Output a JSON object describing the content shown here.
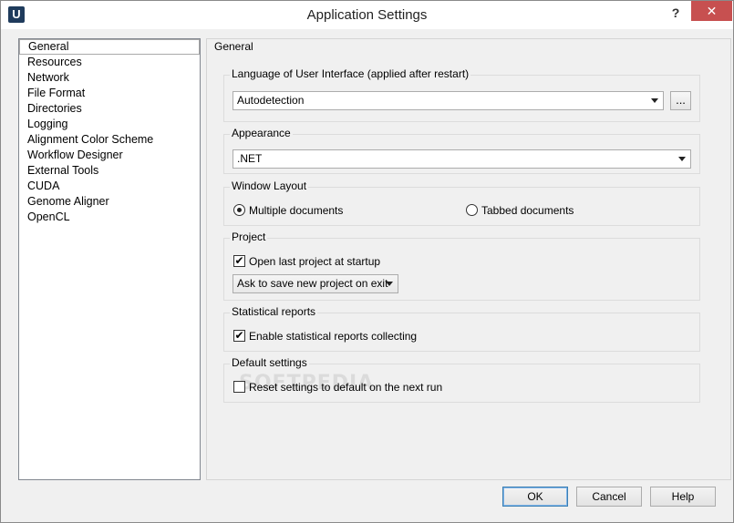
{
  "window": {
    "title": "Application Settings",
    "icon_letter": "U",
    "help_glyph": "?",
    "close_glyph": "✕"
  },
  "sidebar": {
    "items": [
      {
        "label": "General",
        "selected": true
      },
      {
        "label": "Resources"
      },
      {
        "label": "Network"
      },
      {
        "label": "File Format"
      },
      {
        "label": "Directories"
      },
      {
        "label": "Logging"
      },
      {
        "label": "Alignment Color Scheme"
      },
      {
        "label": "Workflow Designer"
      },
      {
        "label": "External Tools"
      },
      {
        "label": "CUDA"
      },
      {
        "label": "Genome Aligner"
      },
      {
        "label": "OpenCL"
      }
    ]
  },
  "panel": {
    "title": "General",
    "language": {
      "group_title": "Language of User Interface (applied after restart)",
      "value": "Autodetection",
      "browse_label": "..."
    },
    "appearance": {
      "group_title": "Appearance",
      "value": ".NET"
    },
    "layout": {
      "group_title": "Window Layout",
      "option_multiple": "Multiple documents",
      "option_tabbed": "Tabbed documents",
      "selected": "multiple"
    },
    "project": {
      "group_title": "Project",
      "open_last_label": "Open last project at startup",
      "open_last_checked": true,
      "save_policy": "Ask to save new project on exit"
    },
    "stats": {
      "group_title": "Statistical reports",
      "enable_label": "Enable statistical reports collecting",
      "enable_checked": true
    },
    "defaults": {
      "group_title": "Default settings",
      "reset_label": "Reset settings to default on the next run",
      "reset_checked": false,
      "watermark": "SOFTPEDIA"
    }
  },
  "buttons": {
    "ok": "OK",
    "cancel": "Cancel",
    "help": "Help"
  },
  "check_glyph": "✔"
}
